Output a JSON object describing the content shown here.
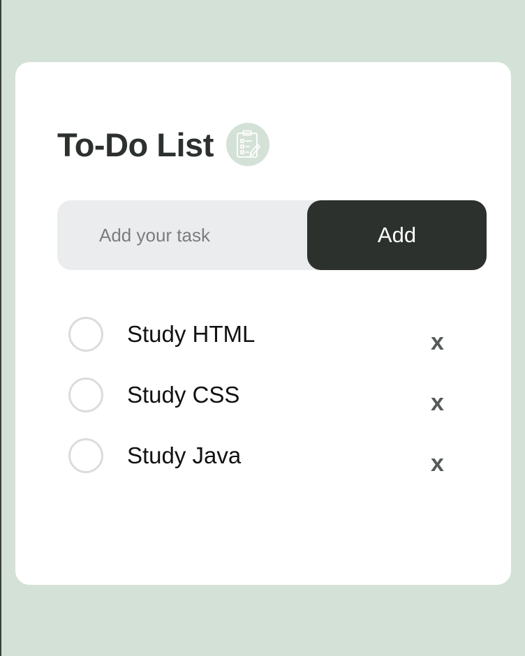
{
  "app": {
    "title": "To-Do List",
    "icon": "clipboard-checklist-icon"
  },
  "input": {
    "placeholder": "Add your task",
    "value": ""
  },
  "add_button": {
    "label": "Add"
  },
  "tasks": [
    {
      "label": "Study HTML",
      "checked": false,
      "delete_label": "x"
    },
    {
      "label": "Study CSS",
      "checked": false,
      "delete_label": "x"
    },
    {
      "label": "Study Java",
      "checked": false,
      "delete_label": "x"
    }
  ],
  "colors": {
    "background": "#d3e1d6",
    "card": "#ffffff",
    "dark": "#2c312d",
    "input_bg": "#ebecee"
  }
}
